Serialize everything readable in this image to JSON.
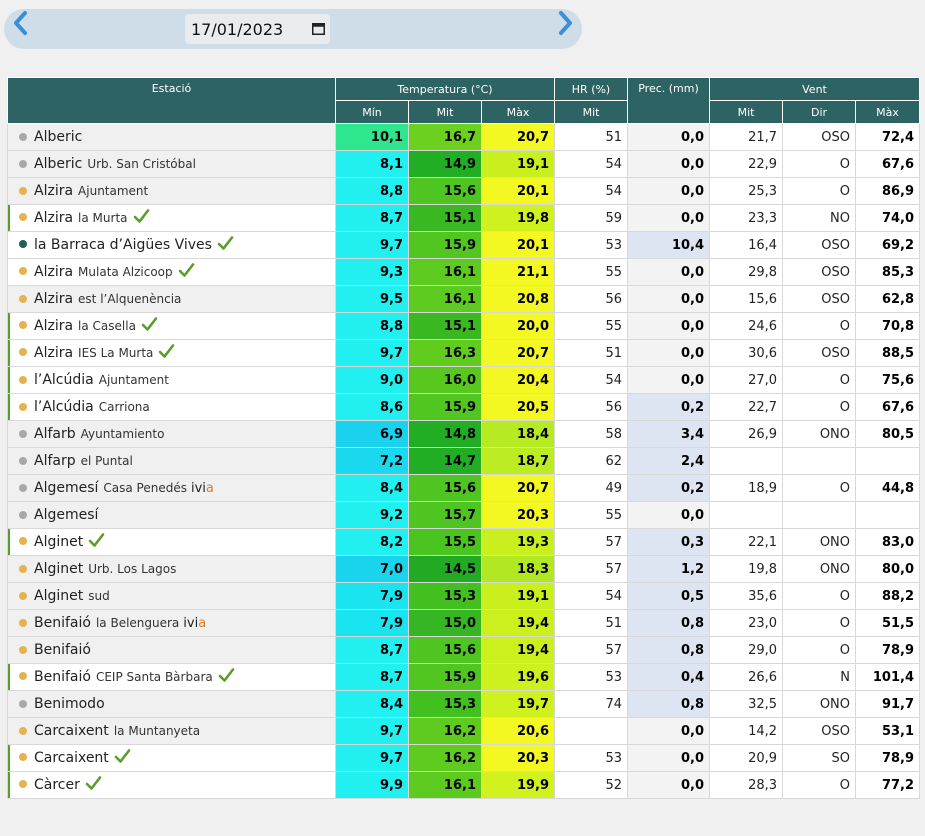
{
  "date_nav": {
    "date_value": "17/01/2023",
    "prev_icon": "chevron-left-icon",
    "next_icon": "chevron-right-icon",
    "calendar_icon": "calendar-icon"
  },
  "colors": {
    "header_bg": "#2e6364",
    "check": "#5a9e2a",
    "dot_grey": "#a8a8a8",
    "dot_orange": "#e6b24c",
    "dot_teal": "#1f5e5c",
    "ivia_accent": "#e07b28"
  },
  "table": {
    "header": {
      "station": "Estació",
      "temperature": "Temperatura (°C)",
      "humidity": "HR (%)",
      "precip": "Prec. (mm)",
      "wind": "Vent",
      "t_min": "Mín",
      "t_avg": "Mit",
      "t_max": "Màx",
      "hr_avg": "Mit",
      "w_avg": "Mit",
      "w_dir": "Dir",
      "w_max": "Màx"
    },
    "rows": [
      {
        "name": "Alberic",
        "sub": "",
        "dot": "grey",
        "check": false,
        "bar": false,
        "ivia": false,
        "tmin": "10,1",
        "tmin_bg": "#2ee68e",
        "tavg": "16,7",
        "tavg_bg": "#6cd01e",
        "tmax": "20,7",
        "tmax_bg": "#f3f722",
        "hr": "51",
        "prec": "0,0",
        "prec_wet": false,
        "wavg": "21,7",
        "wdir": "OSO",
        "wmax": "72,4"
      },
      {
        "name": "Alberic",
        "sub": "Urb. San Cristóbal",
        "dot": "grey",
        "check": false,
        "bar": false,
        "ivia": false,
        "tmin": "8,1",
        "tmin_bg": "#22f0f0",
        "tavg": "14,9",
        "tavg_bg": "#22ae24",
        "tmax": "19,1",
        "tmax_bg": "#c9f01e",
        "hr": "54",
        "prec": "0,0",
        "prec_wet": false,
        "wavg": "22,9",
        "wdir": "O",
        "wmax": "67,6"
      },
      {
        "name": "Alzira",
        "sub": "Ajuntament",
        "dot": "orange",
        "check": false,
        "bar": false,
        "ivia": false,
        "tmin": "8,8",
        "tmin_bg": "#22f0f0",
        "tavg": "15,6",
        "tavg_bg": "#4ec520",
        "tmax": "20,1",
        "tmax_bg": "#f3f722",
        "hr": "54",
        "prec": "0,0",
        "prec_wet": false,
        "wavg": "25,3",
        "wdir": "O",
        "wmax": "86,9"
      },
      {
        "name": "Alzira",
        "sub": "la Murta",
        "dot": "orange",
        "check": true,
        "bar": true,
        "ivia": false,
        "tmin": "8,7",
        "tmin_bg": "#22f0f0",
        "tavg": "15,1",
        "tavg_bg": "#3ab822",
        "tmax": "19,8",
        "tmax_bg": "#cff21e",
        "hr": "59",
        "prec": "0,0",
        "prec_wet": false,
        "wavg": "23,3",
        "wdir": "NO",
        "wmax": "74,0"
      },
      {
        "name": "la Barraca d’Aigües Vives",
        "sub": "",
        "dot": "teal",
        "check": true,
        "bar": false,
        "ivia": false,
        "tmin": "9,7",
        "tmin_bg": "#22f0f0",
        "tavg": "15,9",
        "tavg_bg": "#52c620",
        "tmax": "20,1",
        "tmax_bg": "#f3f722",
        "hr": "53",
        "prec": "10,4",
        "prec_wet": true,
        "wavg": "16,4",
        "wdir": "OSO",
        "wmax": "69,2"
      },
      {
        "name": "Alzira",
        "sub": "Mulata Alzicoop",
        "dot": "orange",
        "check": true,
        "bar": false,
        "ivia": false,
        "tmin": "9,3",
        "tmin_bg": "#22f0f0",
        "tavg": "16,1",
        "tavg_bg": "#5cca1f",
        "tmax": "21,1",
        "tmax_bg": "#f3f722",
        "hr": "55",
        "prec": "0,0",
        "prec_wet": false,
        "wavg": "29,8",
        "wdir": "OSO",
        "wmax": "85,3"
      },
      {
        "name": "Alzira",
        "sub": "est l’Alquenència",
        "dot": "orange",
        "check": false,
        "bar": false,
        "ivia": false,
        "tmin": "9,5",
        "tmin_bg": "#22f0f0",
        "tavg": "16,1",
        "tavg_bg": "#5cca1f",
        "tmax": "20,8",
        "tmax_bg": "#f3f722",
        "hr": "56",
        "prec": "0,0",
        "prec_wet": false,
        "wavg": "15,6",
        "wdir": "OSO",
        "wmax": "62,8"
      },
      {
        "name": "Alzira",
        "sub": "la Casella",
        "dot": "orange",
        "check": true,
        "bar": true,
        "ivia": false,
        "tmin": "8,8",
        "tmin_bg": "#22f0f0",
        "tavg": "15,1",
        "tavg_bg": "#3ab822",
        "tmax": "20,0",
        "tmax_bg": "#f3f722",
        "hr": "55",
        "prec": "0,0",
        "prec_wet": false,
        "wavg": "24,6",
        "wdir": "O",
        "wmax": "70,8"
      },
      {
        "name": "Alzira",
        "sub": "IES La Murta",
        "dot": "orange",
        "check": true,
        "bar": true,
        "ivia": false,
        "tmin": "9,7",
        "tmin_bg": "#22f0f0",
        "tavg": "16,3",
        "tavg_bg": "#62cc1e",
        "tmax": "20,7",
        "tmax_bg": "#f3f722",
        "hr": "51",
        "prec": "0,0",
        "prec_wet": false,
        "wavg": "30,6",
        "wdir": "OSO",
        "wmax": "88,5"
      },
      {
        "name": "l’Alcúdia",
        "sub": "Ajuntament",
        "dot": "orange",
        "check": false,
        "bar": true,
        "ivia": false,
        "tmin": "9,0",
        "tmin_bg": "#22f0f0",
        "tavg": "16,0",
        "tavg_bg": "#58c81f",
        "tmax": "20,4",
        "tmax_bg": "#f3f722",
        "hr": "54",
        "prec": "0,0",
        "prec_wet": false,
        "wavg": "27,0",
        "wdir": "O",
        "wmax": "75,6"
      },
      {
        "name": "l’Alcúdia",
        "sub": "Carriona",
        "dot": "orange",
        "check": false,
        "bar": true,
        "ivia": false,
        "tmin": "8,6",
        "tmin_bg": "#22f0f0",
        "tavg": "15,9",
        "tavg_bg": "#52c620",
        "tmax": "20,5",
        "tmax_bg": "#f3f722",
        "hr": "56",
        "prec": "0,2",
        "prec_wet": true,
        "wavg": "22,7",
        "wdir": "O",
        "wmax": "67,6"
      },
      {
        "name": "Alfarb",
        "sub": "Ayuntamiento",
        "dot": "grey",
        "check": false,
        "bar": false,
        "ivia": false,
        "tmin": "6,9",
        "tmin_bg": "#1ad2ee",
        "tavg": "14,8",
        "tavg_bg": "#22ae24",
        "tmax": "18,4",
        "tmax_bg": "#b6ea22",
        "hr": "58",
        "prec": "3,4",
        "prec_wet": true,
        "wavg": "26,9",
        "wdir": "ONO",
        "wmax": "80,5"
      },
      {
        "name": "Alfarp",
        "sub": "el Puntal",
        "dot": "grey",
        "check": false,
        "bar": false,
        "ivia": false,
        "tmin": "7,2",
        "tmin_bg": "#1ad8ee",
        "tavg": "14,7",
        "tavg_bg": "#22ae24",
        "tmax": "18,7",
        "tmax_bg": "#bcec22",
        "hr": "62",
        "prec": "2,4",
        "prec_wet": true,
        "wavg": "",
        "wdir": "",
        "wmax": ""
      },
      {
        "name": "Algemesí",
        "sub": "Casa Penedés",
        "dot": "grey",
        "check": false,
        "bar": false,
        "ivia": true,
        "tmin": "8,4",
        "tmin_bg": "#22f0f0",
        "tavg": "15,6",
        "tavg_bg": "#4ec520",
        "tmax": "20,7",
        "tmax_bg": "#f3f722",
        "hr": "49",
        "prec": "0,2",
        "prec_wet": true,
        "wavg": "18,9",
        "wdir": "O",
        "wmax": "44,8"
      },
      {
        "name": "Algemesí",
        "sub": "",
        "dot": "grey",
        "check": false,
        "bar": false,
        "ivia": false,
        "tmin": "9,2",
        "tmin_bg": "#22f0f0",
        "tavg": "15,7",
        "tavg_bg": "#4ec520",
        "tmax": "20,3",
        "tmax_bg": "#f3f722",
        "hr": "55",
        "prec": "0,0",
        "prec_wet": false,
        "wavg": "",
        "wdir": "",
        "wmax": ""
      },
      {
        "name": "Alginet",
        "sub": "",
        "dot": "orange",
        "check": true,
        "bar": true,
        "ivia": false,
        "tmin": "8,2",
        "tmin_bg": "#22f0f0",
        "tavg": "15,5",
        "tavg_bg": "#4ac41f",
        "tmax": "19,3",
        "tmax_bg": "#c9f01e",
        "hr": "57",
        "prec": "0,3",
        "prec_wet": true,
        "wavg": "22,1",
        "wdir": "ONO",
        "wmax": "83,0"
      },
      {
        "name": "Alginet",
        "sub": "Urb. Los Lagos",
        "dot": "orange",
        "check": false,
        "bar": false,
        "ivia": false,
        "tmin": "7,0",
        "tmin_bg": "#1ad4ee",
        "tavg": "14,5",
        "tavg_bg": "#22aa24",
        "tmax": "18,3",
        "tmax_bg": "#b2e822",
        "hr": "57",
        "prec": "1,2",
        "prec_wet": true,
        "wavg": "19,8",
        "wdir": "ONO",
        "wmax": "80,0"
      },
      {
        "name": "Alginet",
        "sub": "sud",
        "dot": "orange",
        "check": false,
        "bar": false,
        "ivia": false,
        "tmin": "7,9",
        "tmin_bg": "#1ae4ef",
        "tavg": "15,3",
        "tavg_bg": "#42c020",
        "tmax": "19,1",
        "tmax_bg": "#c9f01e",
        "hr": "54",
        "prec": "0,5",
        "prec_wet": true,
        "wavg": "35,6",
        "wdir": "O",
        "wmax": "88,2"
      },
      {
        "name": "Benifaió",
        "sub": "la Belenguera",
        "dot": "orange",
        "check": false,
        "bar": false,
        "ivia": true,
        "tmin": "7,9",
        "tmin_bg": "#1ae4ef",
        "tavg": "15,0",
        "tavg_bg": "#36b622",
        "tmax": "19,4",
        "tmax_bg": "#cbf01e",
        "hr": "51",
        "prec": "0,8",
        "prec_wet": true,
        "wavg": "23,0",
        "wdir": "O",
        "wmax": "51,5"
      },
      {
        "name": "Benifaió",
        "sub": "",
        "dot": "orange",
        "check": false,
        "bar": false,
        "ivia": false,
        "tmin": "8,7",
        "tmin_bg": "#22f0f0",
        "tavg": "15,6",
        "tavg_bg": "#4ec520",
        "tmax": "19,4",
        "tmax_bg": "#cbf01e",
        "hr": "57",
        "prec": "0,8",
        "prec_wet": true,
        "wavg": "29,0",
        "wdir": "O",
        "wmax": "78,9"
      },
      {
        "name": "Benifaió",
        "sub": "CEIP Santa Bàrbara",
        "dot": "orange",
        "check": true,
        "bar": true,
        "ivia": false,
        "tmin": "8,7",
        "tmin_bg": "#22f0f0",
        "tavg": "15,9",
        "tavg_bg": "#52c620",
        "tmax": "19,6",
        "tmax_bg": "#cdf11e",
        "hr": "53",
        "prec": "0,4",
        "prec_wet": true,
        "wavg": "26,6",
        "wdir": "N",
        "wmax": "101,4"
      },
      {
        "name": "Benimodo",
        "sub": "",
        "dot": "grey",
        "check": false,
        "bar": false,
        "ivia": false,
        "tmin": "8,4",
        "tmin_bg": "#22f0f0",
        "tavg": "15,3",
        "tavg_bg": "#42c020",
        "tmax": "19,7",
        "tmax_bg": "#cff21e",
        "hr": "74",
        "prec": "0,8",
        "prec_wet": true,
        "wavg": "32,5",
        "wdir": "ONO",
        "wmax": "91,7"
      },
      {
        "name": "Carcaixent",
        "sub": "la Muntanyeta",
        "dot": "orange",
        "check": false,
        "bar": false,
        "ivia": false,
        "tmin": "9,7",
        "tmin_bg": "#22f0f0",
        "tavg": "16,2",
        "tavg_bg": "#5fcb1f",
        "tmax": "20,6",
        "tmax_bg": "#f3f722",
        "hr": "",
        "prec": "0,0",
        "prec_wet": false,
        "wavg": "14,2",
        "wdir": "OSO",
        "wmax": "53,1"
      },
      {
        "name": "Carcaixent",
        "sub": "",
        "dot": "orange",
        "check": true,
        "bar": true,
        "ivia": false,
        "tmin": "9,7",
        "tmin_bg": "#22f0f0",
        "tavg": "16,2",
        "tavg_bg": "#5fcb1f",
        "tmax": "20,3",
        "tmax_bg": "#f3f722",
        "hr": "53",
        "prec": "0,0",
        "prec_wet": false,
        "wavg": "20,9",
        "wdir": "SO",
        "wmax": "78,9"
      },
      {
        "name": "Càrcer",
        "sub": "",
        "dot": "orange",
        "check": true,
        "bar": true,
        "ivia": false,
        "tmin": "9,9",
        "tmin_bg": "#22f0f0",
        "tavg": "16,1",
        "tavg_bg": "#5cca1f",
        "tmax": "19,9",
        "tmax_bg": "#d1f21e",
        "hr": "52",
        "prec": "0,0",
        "prec_wet": false,
        "wavg": "28,3",
        "wdir": "O",
        "wmax": "77,2"
      }
    ]
  }
}
